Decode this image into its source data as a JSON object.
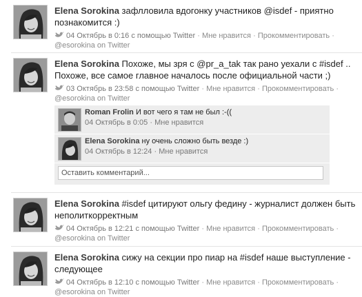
{
  "posts": [
    {
      "author": "Elena Sorokina",
      "text": "зафлловила вдогонку участников @isdef - приятно познакомится :)",
      "time": "04 Октябрь в 0:16 с помощью Twitter",
      "like": "Мне нравится",
      "comment": "Прокомментировать",
      "account": "@esorokina on Twitter"
    },
    {
      "author": "Elena Sorokina",
      "text": "Похоже, мы зря с @pr_a_tak так рано уехали с #isdef .. Похоже, все самое главное началось после официальной части ;)",
      "time": "03 Октябрь в 23:58 с помощью Twitter",
      "like": "Мне нравится",
      "comment": "Прокомментировать",
      "account": "@esorokina on Twitter"
    },
    {
      "author": "Elena Sorokina",
      "text": "#isdef цитируют ольгу федину - журналист должен быть неполиткорректным",
      "time": "04 Октябрь в 12:21 с помощью Twitter",
      "like": "Мне нравится",
      "comment": "Прокомментировать",
      "account": "@esorokina on Twitter"
    },
    {
      "author": "Elena Sorokina",
      "text": "сижу на секции про пиар на #isdef наше выступление - следующее",
      "time": "04 Октябрь в 12:10 с помощью Twitter",
      "like": "Мне нравится",
      "comment": "Прокомментировать",
      "account": "@esorokina on Twitter"
    }
  ],
  "comments": [
    {
      "author": "Roman Frolin",
      "text": "И вот чего я там не был :-((",
      "time": "04 Октябрь в 0:05",
      "like": "Мне нравится"
    },
    {
      "author": "Elena Sorokina",
      "text": "ну очень сложно быть везде :)",
      "time": "04 Октябрь в 12:24",
      "like": "Мне нравится"
    }
  ],
  "comment_box": {
    "placeholder": "Оставить комментарий..."
  },
  "icons": {
    "source": "twitter-bird-icon"
  }
}
